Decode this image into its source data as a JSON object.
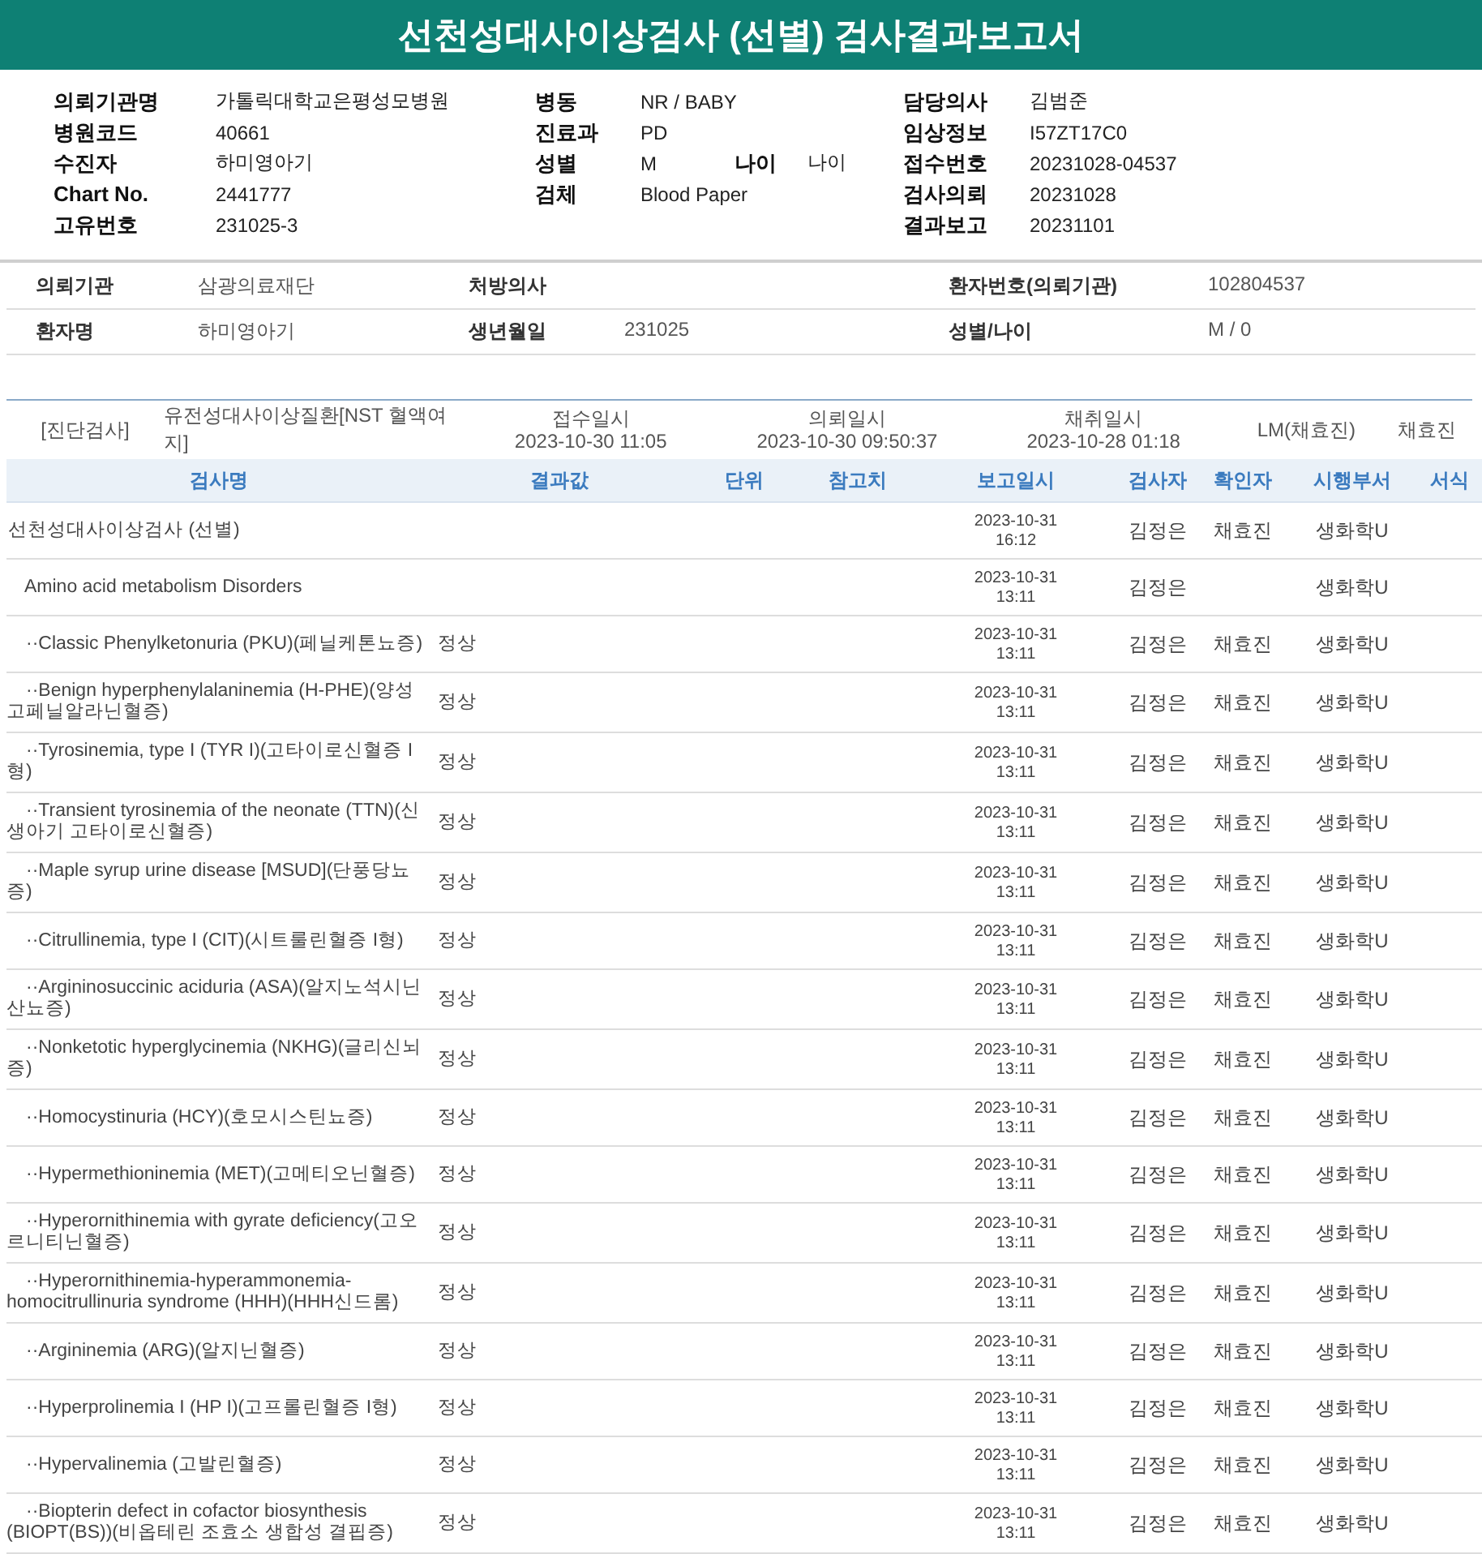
{
  "title": "선천성대사이상검사 (선별) 검사결과보고서",
  "header": {
    "columns": [
      [
        {
          "label": "의뢰기관명",
          "value": "가톨릭대학교은평성모병원"
        },
        {
          "label": "병원코드",
          "value": "40661"
        },
        {
          "label": "수진자",
          "value": "하미영아기"
        },
        {
          "label": "Chart No.",
          "value": "2441777"
        },
        {
          "label": "고유번호",
          "value": "231025-3"
        }
      ],
      [
        {
          "label": "병동",
          "value": "NR / BABY"
        },
        {
          "label": "진료과",
          "value": "PD"
        },
        {
          "label": "성별",
          "value": "M",
          "extra_label": "나이",
          "extra_value": "나이"
        },
        {
          "label": "검체",
          "value": "Blood Paper"
        }
      ],
      [
        {
          "label": "담당의사",
          "value": "김범준"
        },
        {
          "label": "임상정보",
          "value": "I57ZT17C0"
        },
        {
          "label": "접수번호",
          "value": "20231028-04537"
        },
        {
          "label": "검사의뢰",
          "value": "20231028"
        },
        {
          "label": "결과보고",
          "value": "20231101"
        }
      ]
    ]
  },
  "patient": [
    [
      {
        "label": "의뢰기관",
        "value": "삼광의료재단"
      },
      {
        "label": "처방의사"
      },
      {
        "label": "환자번호(의뢰기관)",
        "value": "102804537"
      }
    ],
    [
      {
        "label": "환자명",
        "value": "하미영아기"
      },
      {
        "label": "생년월일",
        "value": "231025"
      },
      {
        "label": "성별/나이",
        "value": "M / 0"
      }
    ]
  ],
  "order": {
    "category": "[진단검사]",
    "test": "유전성대사이상질환[NST 혈액여지]",
    "dates": [
      {
        "label": "접수일시",
        "value": "2023-10-30 11:05"
      },
      {
        "label": "의뢰일시",
        "value": "2023-10-30 09:50:37"
      },
      {
        "label": "채취일시",
        "value": "2023-10-28 01:18"
      }
    ],
    "lab": "LM(채효진)",
    "confirmer": "채효진"
  },
  "table": {
    "columns": [
      "검사명",
      "결과값",
      "단위",
      "참고치",
      "보고일시",
      "검사자",
      "확인자",
      "시행부서",
      "서식"
    ],
    "rows": [
      {
        "name": "선천성대사이상검사 (선별)",
        "date": "2023-10-31",
        "time": "16:12",
        "tester": "김정은",
        "confirmer": "채효진",
        "dept": "생화학U",
        "children": [
          {
            "name": "Amino acid metabolism Disorders",
            "date": "2023-10-31",
            "time": "13:11",
            "tester": "김정은",
            "dept": "생화학U",
            "children": [
              {
                "name": "··Classic Phenylketonuria (PKU)(페닐케톤뇨증)",
                "result": "정상",
                "date": "2023-10-31",
                "time": "13:11",
                "tester": "김정은",
                "confirmer": "채효진",
                "dept": "생화학U"
              },
              {
                "name": "··Benign hyperphenylalaninemia (H-PHE)(양성고페닐알라닌혈증)",
                "result": "정상",
                "date": "2023-10-31",
                "time": "13:11",
                "tester": "김정은",
                "confirmer": "채효진",
                "dept": "생화학U"
              },
              {
                "name": "··Tyrosinemia, type I (TYR I)(고타이로신혈증 I형)",
                "result": "정상",
                "date": "2023-10-31",
                "time": "13:11",
                "tester": "김정은",
                "confirmer": "채효진",
                "dept": "생화학U"
              },
              {
                "name": "··Transient tyrosinemia of the neonate (TTN)(신생아기 고타이로신혈증)",
                "result": "정상",
                "date": "2023-10-31",
                "time": "13:11",
                "tester": "김정은",
                "confirmer": "채효진",
                "dept": "생화학U"
              },
              {
                "name": "··Maple syrup urine disease [MSUD](단풍당뇨증)",
                "result": "정상",
                "date": "2023-10-31",
                "time": "13:11",
                "tester": "김정은",
                "confirmer": "채효진",
                "dept": "생화학U"
              },
              {
                "name": "··Citrullinemia, type I (CIT)(시트룰린혈증 I형)",
                "result": "정상",
                "date": "2023-10-31",
                "time": "13:11",
                "tester": "김정은",
                "confirmer": "채효진",
                "dept": "생화학U"
              },
              {
                "name": "··Argininosuccinic aciduria (ASA)(알지노석시닌산뇨증)",
                "result": "정상",
                "date": "2023-10-31",
                "time": "13:11",
                "tester": "김정은",
                "confirmer": "채효진",
                "dept": "생화학U"
              },
              {
                "name": "··Nonketotic hyperglycinemia (NKHG)(글리신뇌증)",
                "result": "정상",
                "date": "2023-10-31",
                "time": "13:11",
                "tester": "김정은",
                "confirmer": "채효진",
                "dept": "생화학U"
              },
              {
                "name": "··Homocystinuria (HCY)(호모시스틴뇨증)",
                "result": "정상",
                "date": "2023-10-31",
                "time": "13:11",
                "tester": "김정은",
                "confirmer": "채효진",
                "dept": "생화학U"
              },
              {
                "name": "··Hypermethioninemia (MET)(고메티오닌혈증)",
                "result": "정상",
                "date": "2023-10-31",
                "time": "13:11",
                "tester": "김정은",
                "confirmer": "채효진",
                "dept": "생화학U"
              },
              {
                "name": "··Hyperornithinemia with gyrate deficiency(고오르니티닌혈증)",
                "result": "정상",
                "date": "2023-10-31",
                "time": "13:11",
                "tester": "김정은",
                "confirmer": "채효진",
                "dept": "생화학U"
              },
              {
                "name": "··Hyperornithinemia-hyperammonemia-homocitrullinuria syndrome (HHH)(HHH신드롬)",
                "result": "정상",
                "date": "2023-10-31",
                "time": "13:11",
                "tester": "김정은",
                "confirmer": "채효진",
                "dept": "생화학U"
              },
              {
                "name": "··Argininemia (ARG)(알지닌혈증)",
                "result": "정상",
                "date": "2023-10-31",
                "time": "13:11",
                "tester": "김정은",
                "confirmer": "채효진",
                "dept": "생화학U"
              },
              {
                "name": "··Hyperprolinemia I (HP I)(고프롤린혈증 I형)",
                "result": "정상",
                "date": "2023-10-31",
                "time": "13:11",
                "tester": "김정은",
                "confirmer": "채효진",
                "dept": "생화학U"
              },
              {
                "name": "··Hypervalinemia (고발린혈증)",
                "result": "정상",
                "date": "2023-10-31",
                "time": "13:11",
                "tester": "김정은",
                "confirmer": "채효진",
                "dept": "생화학U"
              },
              {
                "name": "··Biopterin defect in cofactor biosynthesis (BIOPT(BS))(비옵테린 조효소 생합성 결핍증)",
                "result": "정상",
                "date": "2023-10-31",
                "time": "13:11",
                "tester": "김정은",
                "confirmer": "채효진",
                "dept": "생화학U"
              }
            ]
          }
        ]
      }
    ]
  }
}
